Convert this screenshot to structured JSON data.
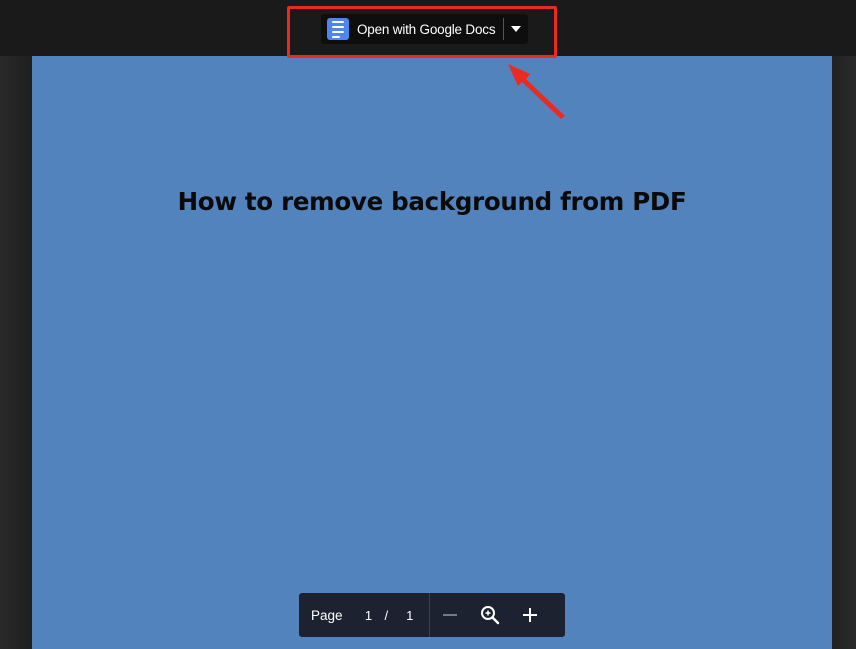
{
  "toolbar": {
    "open_with_label": "Open with Google Docs",
    "app_icon": "google-docs-icon",
    "dropdown_icon": "caret-down-icon"
  },
  "document": {
    "title": "How to remove background from PDF",
    "page_color": "#5283bc"
  },
  "page_controls": {
    "page_label": "Page",
    "current_page": "1",
    "separator": "/",
    "total_pages": "1",
    "zoom_out_icon": "minus-icon",
    "zoom_reset_icon": "zoom-icon",
    "zoom_in_icon": "plus-icon"
  },
  "annotation": {
    "highlight_color": "#ea2b22"
  }
}
